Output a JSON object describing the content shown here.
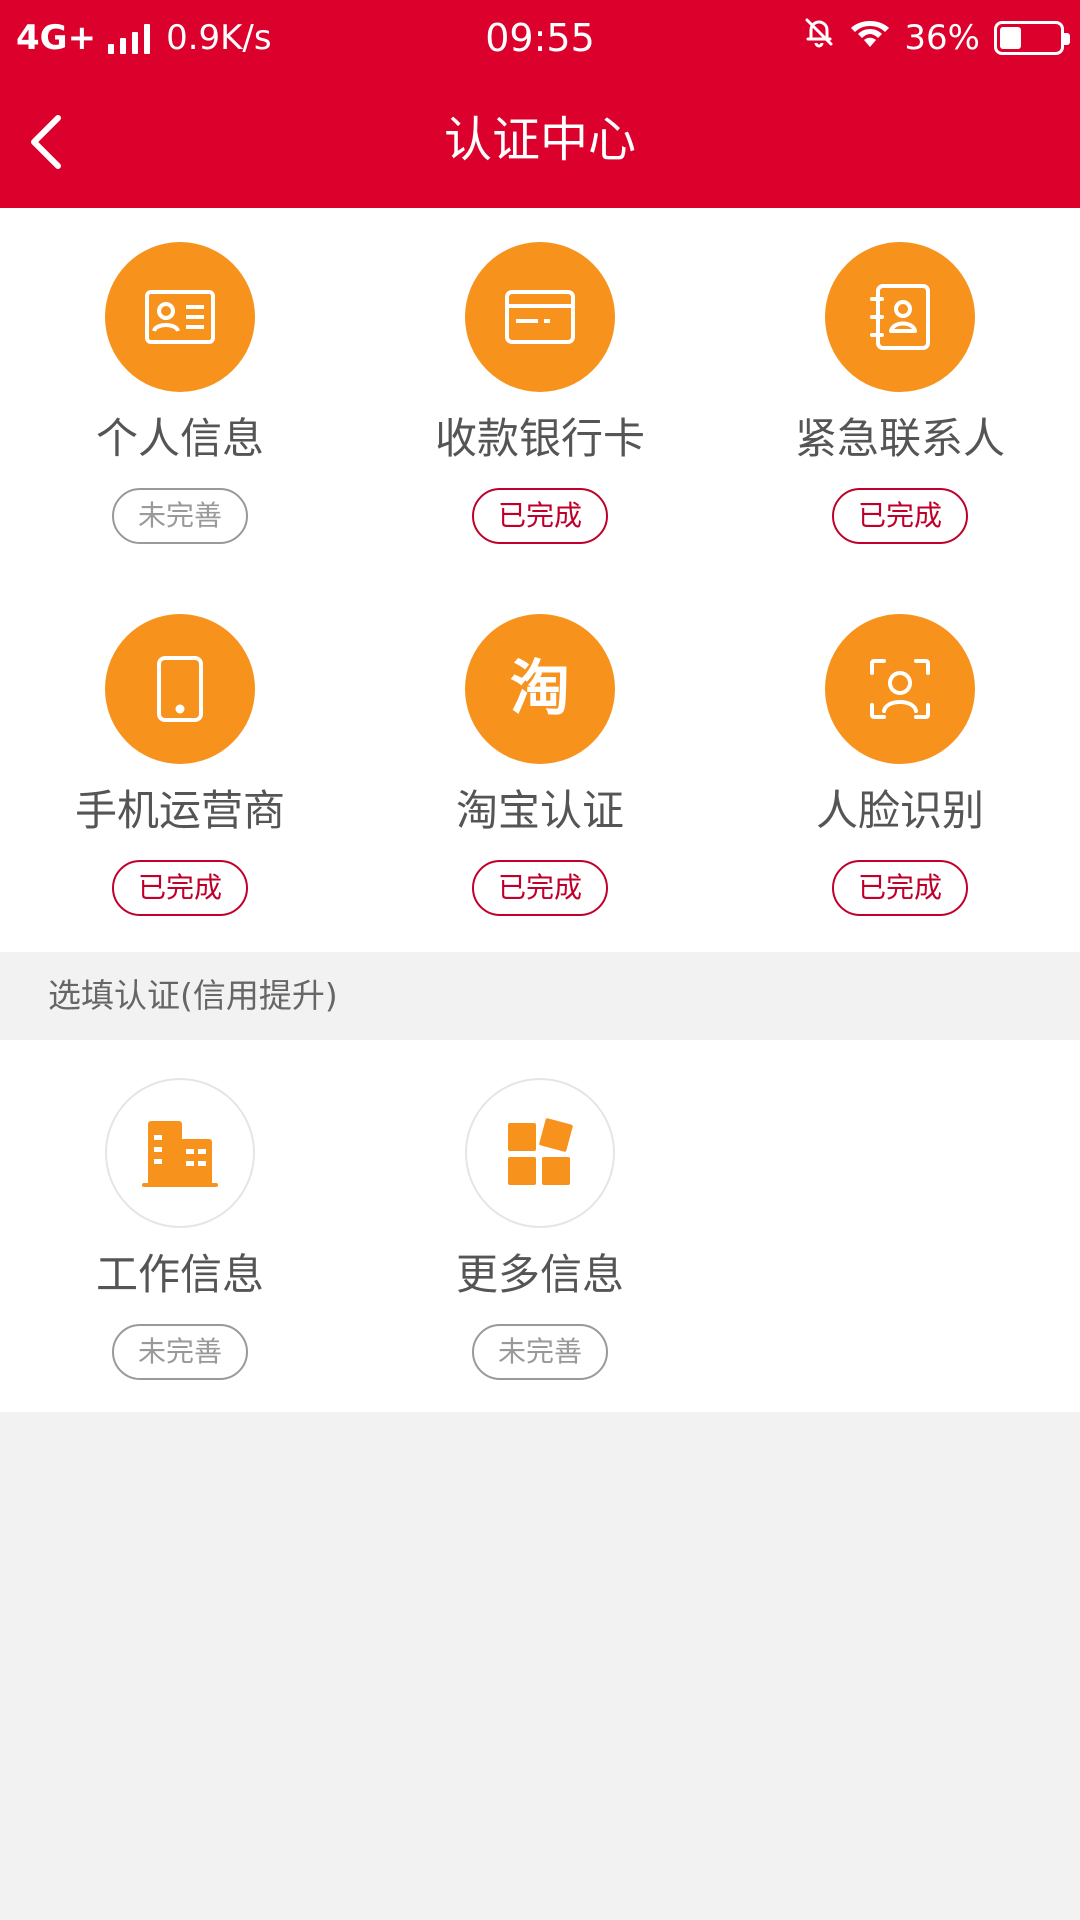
{
  "status_bar": {
    "network": "4G+",
    "speed": "0.9K/s",
    "time": "09:55",
    "battery": "36%",
    "battery_level": 0.36
  },
  "header": {
    "title": "认证中心"
  },
  "required": {
    "items": [
      {
        "label": "个人信息",
        "status": "未完善",
        "icon": "id-card-icon"
      },
      {
        "label": "收款银行卡",
        "status": "已完成",
        "icon": "bank-card-icon"
      },
      {
        "label": "紧急联系人",
        "status": "已完成",
        "icon": "contact-book-icon"
      },
      {
        "label": "手机运营商",
        "status": "已完成",
        "icon": "mobile-phone-icon"
      },
      {
        "label": "淘宝认证",
        "status": "已完成",
        "icon": "taobao-icon",
        "glyph": "淘"
      },
      {
        "label": "人脸识别",
        "status": "已完成",
        "icon": "face-scan-icon"
      }
    ]
  },
  "optional": {
    "section_title": "选填认证(信用提升)",
    "items": [
      {
        "label": "工作信息",
        "status": "未完善",
        "icon": "building-icon"
      },
      {
        "label": "更多信息",
        "status": "未完善",
        "icon": "blocks-icon"
      }
    ]
  },
  "colors": {
    "brand_red": "#DC002C",
    "accent_orange": "#F7921D",
    "done_red": "#C0002A",
    "pending_gray": "#999999"
  }
}
